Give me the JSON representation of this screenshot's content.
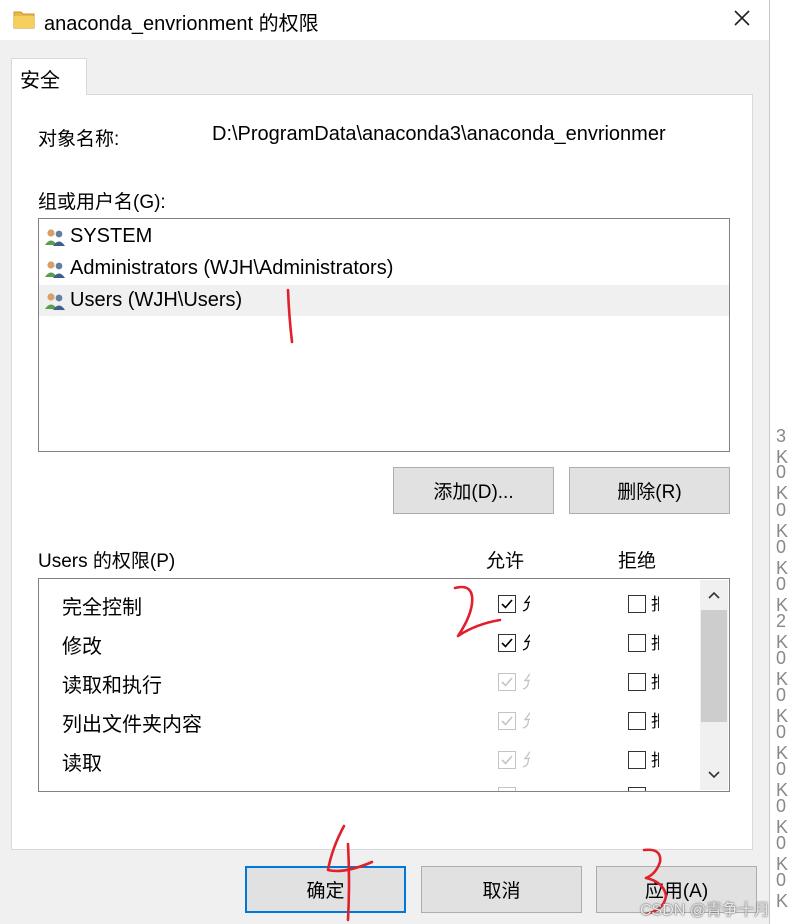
{
  "window": {
    "title": "anaconda_envrionment 的权限",
    "folder_icon": "folder-icon",
    "close_icon": "close-icon"
  },
  "tabs": [
    {
      "label": "安全",
      "selected": true
    }
  ],
  "object": {
    "label": "对象名称:",
    "value": "D:\\ProgramData\\anaconda3\\anaconda_envrionmer"
  },
  "groups": {
    "label": "组或用户名(G):",
    "items": [
      {
        "name": "SYSTEM",
        "icon": "user-group-icon",
        "selected": false
      },
      {
        "name": "Administrators (WJH\\Administrators)",
        "icon": "user-group-icon",
        "selected": false
      },
      {
        "name": "Users (WJH\\Users)",
        "icon": "user-group-icon",
        "selected": true
      }
    ],
    "add_button": "添加(D)...",
    "remove_button": "删除(R)"
  },
  "permissions": {
    "label": "Users 的权限(P)",
    "allow_header": "允许",
    "deny_header": "拒绝",
    "allow_tail": "允",
    "deny_tail": "拒",
    "items": [
      {
        "name": "完全控制",
        "allow": true,
        "allow_enabled": true,
        "deny": false
      },
      {
        "name": "修改",
        "allow": true,
        "allow_enabled": true,
        "deny": false
      },
      {
        "name": "读取和执行",
        "allow": true,
        "allow_enabled": false,
        "deny": false
      },
      {
        "name": "列出文件夹内容",
        "allow": true,
        "allow_enabled": false,
        "deny": false
      },
      {
        "name": "读取",
        "allow": true,
        "allow_enabled": false,
        "deny": false
      }
    ]
  },
  "footer": {
    "ok_button": "确定",
    "cancel_button": "取消",
    "apply_button": "应用(A)"
  },
  "background_glyphs": [
    "3 K",
    "0 K",
    "0 K",
    "0 K",
    "0 K",
    "2 K",
    "0 K",
    "0 K",
    "0 K",
    "0 K",
    "0 K",
    "0 K",
    "0 K"
  ],
  "annotations": {
    "marks": [
      "1",
      "2",
      "3",
      "4"
    ],
    "color": "#e0202a"
  },
  "watermark": "CSDN @青争十月",
  "colors": {
    "dialog_bg": "#f0f0f0",
    "focus_border": "#0078d7",
    "button_bg": "#e1e1e1",
    "selection_bg": "#f0f0f0"
  }
}
